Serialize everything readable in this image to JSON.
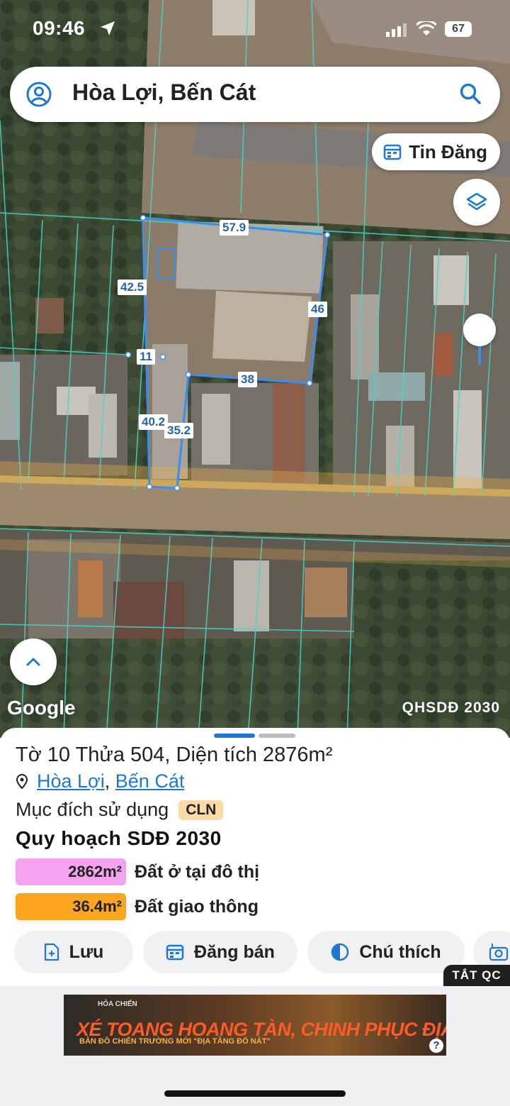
{
  "status_bar": {
    "time": "09:46",
    "battery": "67"
  },
  "search": {
    "location": "Hòa Lợi, Bến Cát"
  },
  "map": {
    "listing_button": "Tin Đăng",
    "plot_dimensions": [
      "57.9",
      "42.5",
      "46",
      "11",
      "38",
      "40.2",
      "35.2"
    ],
    "attribution": "Google",
    "layer_name": "QHSDĐ 2030"
  },
  "parcel": {
    "title": "Tờ 10 Thửa 504, Diện tích 2876m²",
    "ward": "Hòa Lợi",
    "district": "Bến Cát",
    "land_use_label": "Mục đích sử dụng",
    "land_use_code": "CLN",
    "plan_heading": "Quy hoạch SDĐ 2030",
    "plan_items": [
      {
        "area": "2862m²",
        "label": "Đất ở tại đô thị",
        "color": "#f5a3ef"
      },
      {
        "area": "36.4m²",
        "label": "Đất giao thông",
        "color": "#fba51f"
      }
    ]
  },
  "actions": {
    "save": "Lưu",
    "post_sale": "Đăng bán",
    "legend": "Chú thích"
  },
  "ad": {
    "close_label": "TẮT QC",
    "headline": "XÉ TOANG HOANG TÀN, CHINH PHỤC ĐỊA TẦNG",
    "subline": "BẢN ĐỒ CHIẾN TRƯỜNG MỚI \"ĐỊA TẦNG ĐỔ NÁT\"",
    "brand": "HỎA CHIẾN"
  },
  "colors": {
    "accent": "#1d78d2",
    "plot_outline": "#3b8df0"
  }
}
